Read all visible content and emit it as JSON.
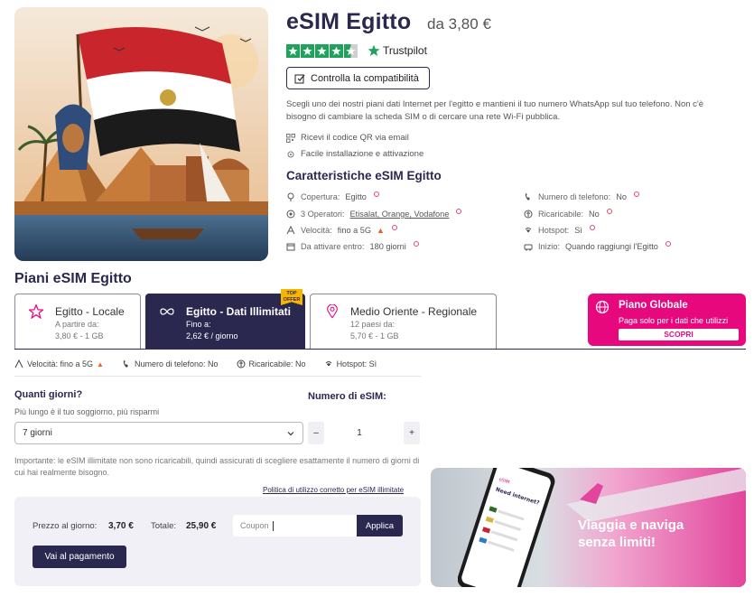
{
  "product": {
    "title": "eSIM Egitto",
    "price_from": "da 3,80 €",
    "rating_stars": 4.5,
    "trustpilot_label": "Trustpilot",
    "compat_button": "Controlla la compatibilità",
    "description": "Scegli uno dei nostri piani dati Internet per l'egitto e mantieni il tuo numero WhatsApp sul tuo telefono. Non c'è bisogno di cambiare la scheda SIM o di cercare una rete Wi-Fi pubblica.",
    "bullets": [
      "Ricevi il codice QR via email",
      "Facile installazione e attivazione"
    ]
  },
  "features": {
    "heading": "Caratteristiche eSIM Egitto",
    "coverage_label": "Copertura:",
    "coverage_value": "Egitto",
    "operators_label": "3 Operatori:",
    "operators_value": "Etisalat, Orange, Vodafone",
    "speed_label": "Velocità:",
    "speed_value": "fino a 5G",
    "activation_label": "Da attivare entro:",
    "activation_value": "180 giorni",
    "phone_label": "Numero di telefono:",
    "phone_value": "No",
    "recharge_label": "Ricaricabile:",
    "recharge_value": "No",
    "hotspot_label": "Hotspot:",
    "hotspot_value": "Sì",
    "start_label": "Inizio:",
    "start_value": "Quando raggiungi l'Egitto"
  },
  "plans": {
    "heading": "Piani eSIM Egitto",
    "items": [
      {
        "name": "Egitto - Locale",
        "sub1": "A partire da:",
        "sub2": "3,80 € - 1 GB"
      },
      {
        "name": "Egitto - Dati Illimitati",
        "sub1": "Fino a:",
        "sub2": "2,62 € / giorno",
        "badge": "TOP OFFER"
      },
      {
        "name": "Medio Oriente - Regionale",
        "sub1": "12 paesi da:",
        "sub2": "5,70 € - 1 GB"
      }
    ],
    "global": {
      "name": "Piano Globale",
      "sub": "Paga solo per i dati che utilizzi",
      "button": "SCOPRI"
    }
  },
  "specs": {
    "speed": "Velocità: fino a 5G",
    "phone": "Numero di telefono: No",
    "recharge": "Ricaricabile: No",
    "hotspot": "Hotspot: Sì"
  },
  "order": {
    "days_heading": "Quanti giorni?",
    "days_sub": "Più lungo è il tuo soggiorno, più risparmi",
    "days_selected": "7 giorni",
    "esim_heading": "Numero di eSIM:",
    "quantity": "1",
    "minus": "–",
    "plus": "+",
    "note": "Importante: le eSIM illimitate non sono ricaricabili, quindi assicurati di scegliere esattamente il numero di giorni di cui hai realmente bisogno.",
    "policy_link": "Politica di utilizzo corretto per eSIM illimitate"
  },
  "checkout": {
    "day_price_label": "Prezzo al giorno:",
    "day_price_value": "3,70 €",
    "total_label": "Totale:",
    "total_value": "25,90 €",
    "coupon_placeholder": "Coupon",
    "apply_label": "Applica",
    "pay_label": "Vai al pagamento"
  },
  "promo": {
    "line1": "Viaggia e naviga",
    "line2": "senza limiti!"
  },
  "colors": {
    "navy": "#2b2850",
    "pink": "#e8087e",
    "trust_green": "#1fa35c",
    "offer_yellow": "#f7b500"
  }
}
